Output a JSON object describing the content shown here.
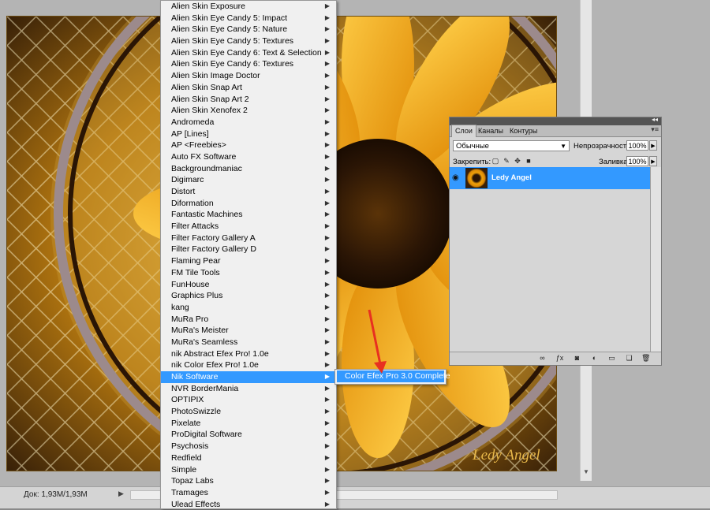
{
  "menu": {
    "items": [
      {
        "label": "Alien Skin Exposure"
      },
      {
        "label": "Alien Skin Eye Candy 5: Impact"
      },
      {
        "label": "Alien Skin Eye Candy 5: Nature"
      },
      {
        "label": "Alien Skin Eye Candy 5: Textures"
      },
      {
        "label": "Alien Skin Eye Candy 6: Text & Selection"
      },
      {
        "label": "Alien Skin Eye Candy 6: Textures"
      },
      {
        "label": "Alien Skin Image Doctor"
      },
      {
        "label": "Alien Skin Snap Art"
      },
      {
        "label": "Alien Skin Snap Art 2"
      },
      {
        "label": "Alien Skin Xenofex 2"
      },
      {
        "label": "Andromeda"
      },
      {
        "label": "AP [Lines]"
      },
      {
        "label": "AP <Freebies>"
      },
      {
        "label": "Auto FX Software"
      },
      {
        "label": "Backgroundmaniac"
      },
      {
        "label": "Digimarc"
      },
      {
        "label": "Distort"
      },
      {
        "label": "Diformation"
      },
      {
        "label": "Fantastic Machines"
      },
      {
        "label": "Filter Attacks"
      },
      {
        "label": "Filter Factory Gallery A"
      },
      {
        "label": "Filter Factory Gallery D"
      },
      {
        "label": "Flaming Pear"
      },
      {
        "label": "FM Tile Tools"
      },
      {
        "label": "FunHouse"
      },
      {
        "label": "Graphics Plus"
      },
      {
        "label": "kang"
      },
      {
        "label": "MuRa Pro"
      },
      {
        "label": "MuRa's Meister"
      },
      {
        "label": "MuRa's Seamless"
      },
      {
        "label": "nik Abstract Efex Pro! 1.0e"
      },
      {
        "label": "nik Color Efex Pro! 1.0e"
      },
      {
        "label": "Nik Software"
      },
      {
        "label": "NVR BorderMania"
      },
      {
        "label": "OPTIPIX"
      },
      {
        "label": "PhotoSwizzle"
      },
      {
        "label": "Pixelate"
      },
      {
        "label": "ProDigital Software"
      },
      {
        "label": "Psychosis"
      },
      {
        "label": "Redfield"
      },
      {
        "label": "Simple"
      },
      {
        "label": "Topaz Labs"
      },
      {
        "label": "Tramages"
      },
      {
        "label": "Ulead Effects"
      }
    ],
    "highlighted_index": 32
  },
  "submenu": {
    "label": "Color Efex Pro 3.0 Complete"
  },
  "layers_panel": {
    "tabs": [
      "Слои",
      "Каналы",
      "Контуры"
    ],
    "blend_mode": "Обычные",
    "opacity_label": "Непрозрачность:",
    "opacity_value": "100%",
    "lock_label": "Закрепить:",
    "fill_label": "Заливка:",
    "fill_value": "100%",
    "layer_name": "Ledy Angel"
  },
  "canvas": {
    "signature": "Ledy Angel"
  },
  "status": {
    "doc_info": "Док: 1,93M/1,93M"
  },
  "colors": {
    "highlight": "#3399ff",
    "menu_bg": "#f0f0f0",
    "petal": "#f5a81a"
  },
  "icons": {
    "submenu_arrow": "triangle-right-icon",
    "eye": "eye-icon",
    "link": "link-icon",
    "fx": "fx-icon"
  }
}
